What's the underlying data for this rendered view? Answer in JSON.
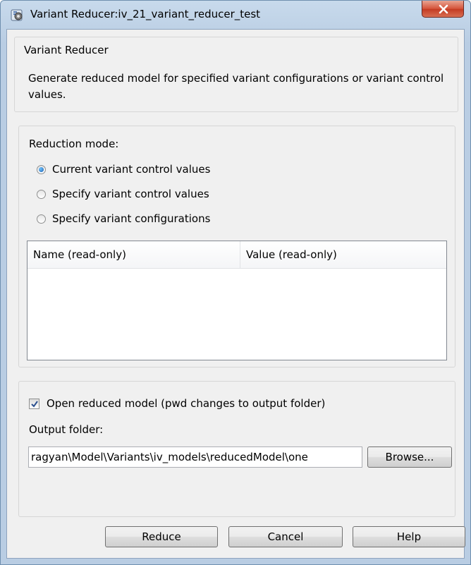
{
  "window": {
    "title": "Variant Reducer:iv_21_variant_reducer_test",
    "close_glyph": "X"
  },
  "header_group": {
    "legend": "Variant Reducer",
    "description": "Generate reduced model for specified variant configurations or variant control values."
  },
  "reduction": {
    "label": "Reduction mode:",
    "options": [
      {
        "label": "Current variant control values",
        "selected": true
      },
      {
        "label": "Specify variant control values",
        "selected": false
      },
      {
        "label": "Specify variant configurations",
        "selected": false
      }
    ],
    "table": {
      "columns": [
        "Name (read-only)",
        "Value (read-only)"
      ],
      "rows": []
    }
  },
  "output": {
    "open_checkbox_label": "Open reduced model (pwd changes to output folder)",
    "open_checked": true,
    "folder_label": "Output folder:",
    "folder_value": "ragyan\\Model\\Variants\\iv_models\\reducedModel\\one",
    "browse_label": "Browse..."
  },
  "buttons": {
    "reduce": "Reduce",
    "cancel": "Cancel",
    "help": "Help"
  },
  "colors": {
    "accent_radio": "#1e5fae",
    "close_button": "#c33a22",
    "title_bar": "#b9cde3"
  },
  "icons": {
    "window_icon": "variant-reducer-icon",
    "close": "close-icon",
    "check": "checkmark-icon"
  }
}
